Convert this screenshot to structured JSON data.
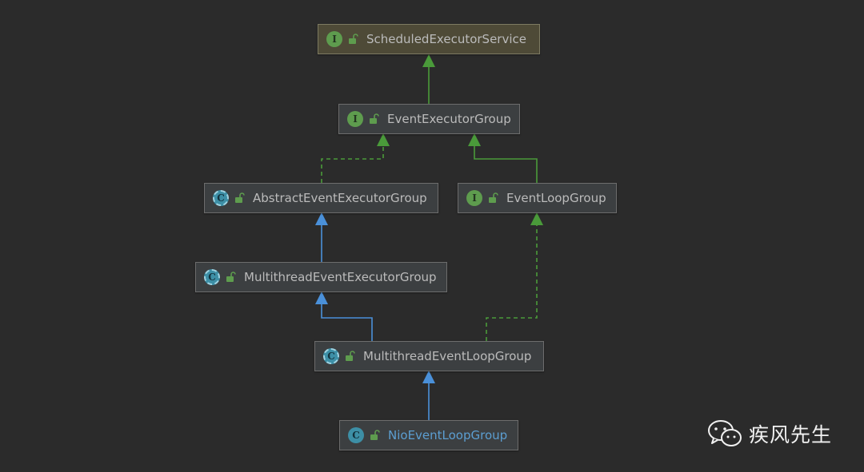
{
  "nodes": {
    "scheduled_executor_service": {
      "label": "ScheduledExecutorService",
      "kind": "I",
      "kind_type": "interface"
    },
    "event_executor_group": {
      "label": "EventExecutorGroup",
      "kind": "I",
      "kind_type": "interface"
    },
    "abstract_event_executor_group": {
      "label": "AbstractEventExecutorGroup",
      "kind": "C",
      "kind_type": "abstract-class"
    },
    "event_loop_group": {
      "label": "EventLoopGroup",
      "kind": "I",
      "kind_type": "interface"
    },
    "multithread_event_executor_group": {
      "label": "MultithreadEventExecutorGroup",
      "kind": "C",
      "kind_type": "abstract-class"
    },
    "multithread_event_loop_group": {
      "label": "MultithreadEventLoopGroup",
      "kind": "C",
      "kind_type": "abstract-class"
    },
    "nio_event_loop_group": {
      "label": "NioEventLoopGroup",
      "kind": "C",
      "kind_type": "class"
    }
  },
  "edges": [
    {
      "from": "event_executor_group",
      "to": "scheduled_executor_service",
      "relation": "extends-interface",
      "style": "solid",
      "color": "#4a9a3a"
    },
    {
      "from": "abstract_event_executor_group",
      "to": "event_executor_group",
      "relation": "implements",
      "style": "dashed",
      "color": "#4a9a3a"
    },
    {
      "from": "event_loop_group",
      "to": "event_executor_group",
      "relation": "extends-interface",
      "style": "solid",
      "color": "#4a9a3a"
    },
    {
      "from": "multithread_event_executor_group",
      "to": "abstract_event_executor_group",
      "relation": "extends",
      "style": "solid",
      "color": "#4a90d9"
    },
    {
      "from": "multithread_event_loop_group",
      "to": "multithread_event_executor_group",
      "relation": "extends",
      "style": "solid",
      "color": "#4a90d9"
    },
    {
      "from": "multithread_event_loop_group",
      "to": "event_loop_group",
      "relation": "implements",
      "style": "dashed",
      "color": "#4a9a3a"
    },
    {
      "from": "nio_event_loop_group",
      "to": "multithread_event_loop_group",
      "relation": "extends",
      "style": "solid",
      "color": "#4a90d9"
    }
  ],
  "colors": {
    "background": "#2b2b2b",
    "interface_badge": "#5e9c4e",
    "class_badge": "#3d8fa6",
    "inheritance_arrow": "#4a90d9",
    "interface_arrow": "#4a9a3a"
  },
  "watermark": {
    "icon": "wechat-icon",
    "text": "疾风先生"
  }
}
